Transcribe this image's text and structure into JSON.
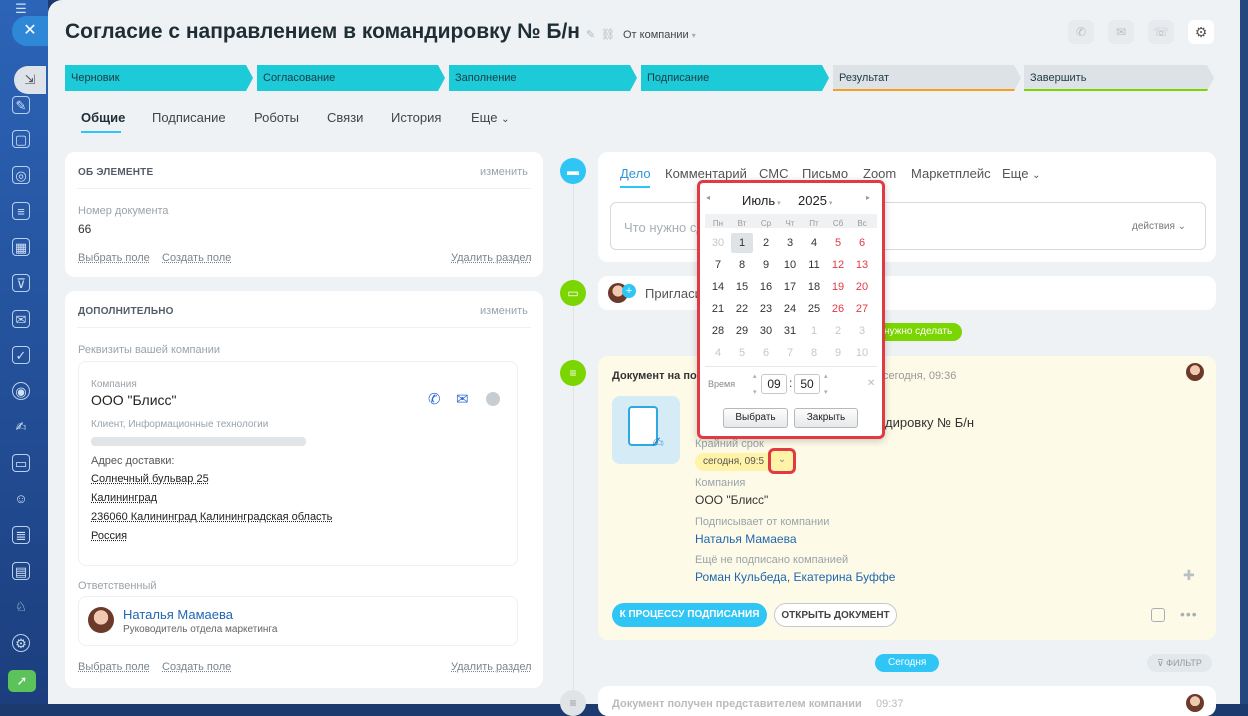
{
  "header": {
    "title": "Согласие с направлением в командировку № Б/н",
    "from_company": "От компании"
  },
  "stages": [
    {
      "label": "Черновик",
      "color": "#1ccad8"
    },
    {
      "label": "Согласование",
      "color": "#1ccad8"
    },
    {
      "label": "Заполнение",
      "color": "#1ccad8"
    },
    {
      "label": "Подписание",
      "color": "#1ccad8"
    },
    {
      "label": "Результат",
      "color": "#dde2e6"
    },
    {
      "label": "Завершить",
      "color": "#dde2e6"
    }
  ],
  "tabs": [
    "Общие",
    "Подписание",
    "Роботы",
    "Связи",
    "История",
    "Еще"
  ],
  "about": {
    "title": "ОБ ЭЛЕМЕНТЕ",
    "edit": "изменить",
    "doc_label": "Номер документа",
    "doc_value": "66",
    "choose_field": "Выбрать поле",
    "create_field": "Создать поле",
    "delete_section": "Удалить раздел"
  },
  "extra": {
    "title": "ДОПОЛНИТЕЛЬНО",
    "edit": "изменить",
    "req_label": "Реквизиты вашей компании",
    "company_label": "Компания",
    "company_value": "ООО \"Блисс\"",
    "client_label": "Клиент, Информационные технологии",
    "address_label": "Адрес доставки:",
    "addr1": "Солнечный бульвар 25",
    "addr2": "Калининград",
    "addr3": "236060 Калининград Калининградская область",
    "addr4": "Россия",
    "resp_label": "Ответственный",
    "resp_name": "Наталья Мамаева",
    "resp_role": "Руководитель отдела маркетинга",
    "choose_field": "Выбрать поле",
    "create_field": "Создать поле",
    "delete_section": "Удалить раздел"
  },
  "activity": {
    "tabs": [
      "Дело",
      "Комментарий",
      "СМС",
      "Письмо",
      "Zoom",
      "Маркетплейс",
      "Еще"
    ],
    "placeholder": "Что нужно сделать",
    "actions": "действия"
  },
  "invite": {
    "text": "Пригласи"
  },
  "todo_badge": "нужно сделать",
  "doc_item": {
    "title": "Документ на по",
    "time": "сегодня, 09:36",
    "doc_name": "дировку № Б/н",
    "deadline_label": "Крайний срок",
    "deadline_value": "сегодня, 09:5",
    "company_label": "Компания",
    "company_value": "ООО \"Блисс\"",
    "signer_label": "Подписывает от компании",
    "signer_value": "Наталья Мамаева",
    "notsigned_label": "Ещё не подписано компанией",
    "notsigned_value": "Роман Кульбеда, Екатерина Буффе",
    "btn_sign": "К ПРОЦЕССУ ПОДПИСАНИЯ",
    "btn_open": "ОТКРЫТЬ ДОКУМЕНТ"
  },
  "today_badge": "Сегодня",
  "filter": "ФИЛЬТР",
  "bottom_item": {
    "title": "Документ получен представителем компании",
    "time": "09:37"
  },
  "calendar": {
    "month": "Июль",
    "year": "2025",
    "weekdays": [
      "Пн",
      "Вт",
      "Ср",
      "Чт",
      "Пт",
      "Сб",
      "Вс"
    ],
    "weeks": [
      [
        "30",
        "1",
        "2",
        "3",
        "4",
        "5",
        "6"
      ],
      [
        "7",
        "8",
        "9",
        "10",
        "11",
        "12",
        "13"
      ],
      [
        "14",
        "15",
        "16",
        "17",
        "18",
        "19",
        "20"
      ],
      [
        "21",
        "22",
        "23",
        "24",
        "25",
        "26",
        "27"
      ],
      [
        "28",
        "29",
        "30",
        "31",
        "1",
        "2",
        "3"
      ],
      [
        "4",
        "5",
        "6",
        "7",
        "8",
        "9",
        "10"
      ]
    ],
    "time_label": "Время",
    "hours": "09",
    "minutes": "50",
    "select": "Выбрать",
    "close": "Закрыть"
  }
}
